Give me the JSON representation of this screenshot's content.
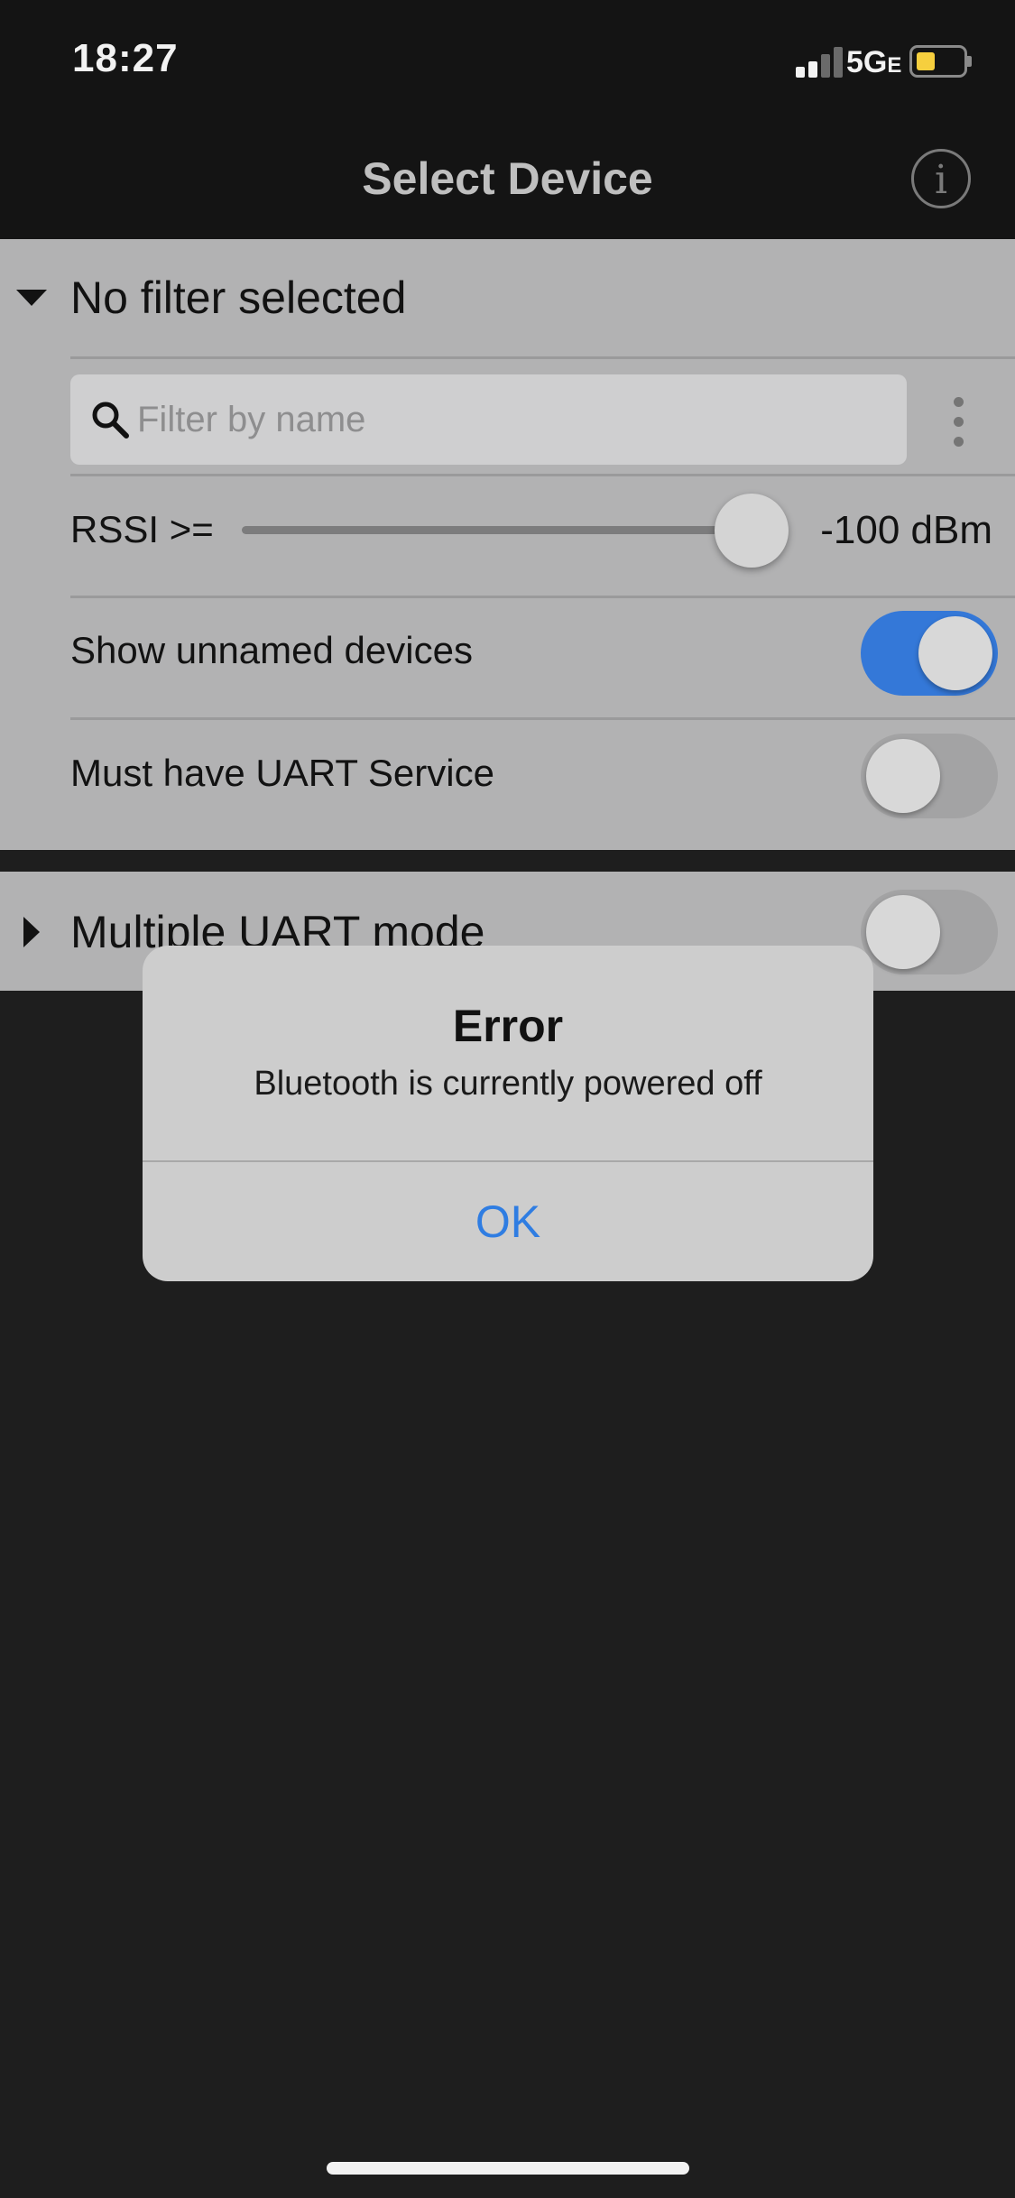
{
  "status_bar": {
    "time": "18:27",
    "network": "5G",
    "network_sub": "E",
    "battery_color": "#f6cf3e"
  },
  "nav": {
    "title": "Select Device",
    "info_icon": "i"
  },
  "filter": {
    "title": "No filter selected",
    "search_placeholder": "Filter by name",
    "rssi_label": "RSSI >=",
    "rssi_value": "-100 dBm",
    "show_unnamed_label": "Show unnamed devices",
    "show_unnamed_on": true,
    "uart_service_label": "Must have UART Service",
    "uart_service_on": false
  },
  "uart_mode": {
    "title": "Multiple UART mode",
    "on": false
  },
  "alert": {
    "title": "Error",
    "message": "Bluetooth is currently powered off",
    "ok_label": "OK"
  },
  "colors": {
    "accent": "#2f7de2",
    "toggle_on": "#3478d8",
    "toggle_off": "#a3a3a4",
    "panel_bg": "#b2b2b3"
  }
}
